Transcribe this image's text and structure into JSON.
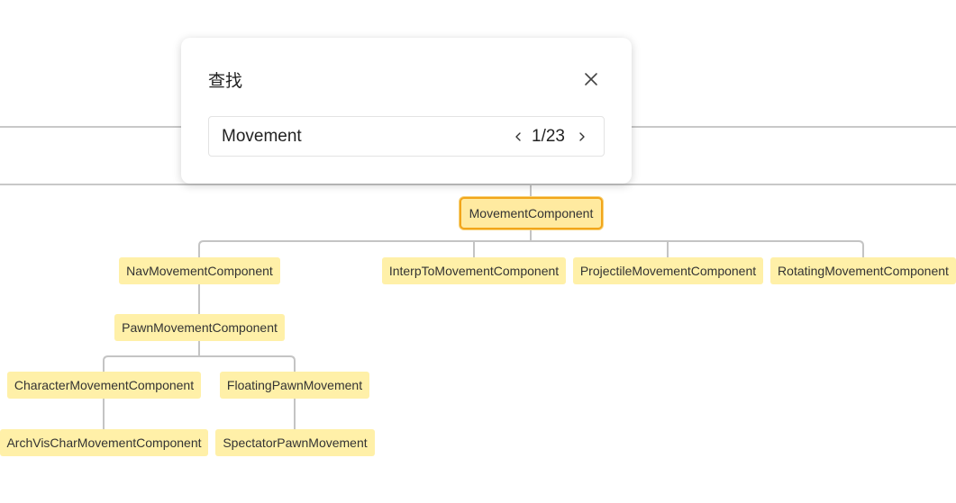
{
  "dialog": {
    "title": "查找",
    "search_value": "Movement",
    "search_placeholder": "",
    "match_current": 1,
    "match_total": 23,
    "counter_text": "1/23"
  },
  "tree": {
    "root": "MovementComponent",
    "nodes": {
      "nav": "NavMovementComponent",
      "interp": "InterpToMovementComponent",
      "projectile": "ProjectileMovementComponent",
      "rotating": "RotatingMovementComponent",
      "pawn": "PawnMovementComponent",
      "character": "CharacterMovementComponent",
      "floating": "FloatingPawnMovement",
      "archvis": "ArchVisCharMovementComponent",
      "spectator": "SpectatorPawnMovement"
    }
  },
  "colors": {
    "node_fill": "#fff0a8",
    "highlight_border": "#f2a51a",
    "connector": "#c4c4c4"
  }
}
